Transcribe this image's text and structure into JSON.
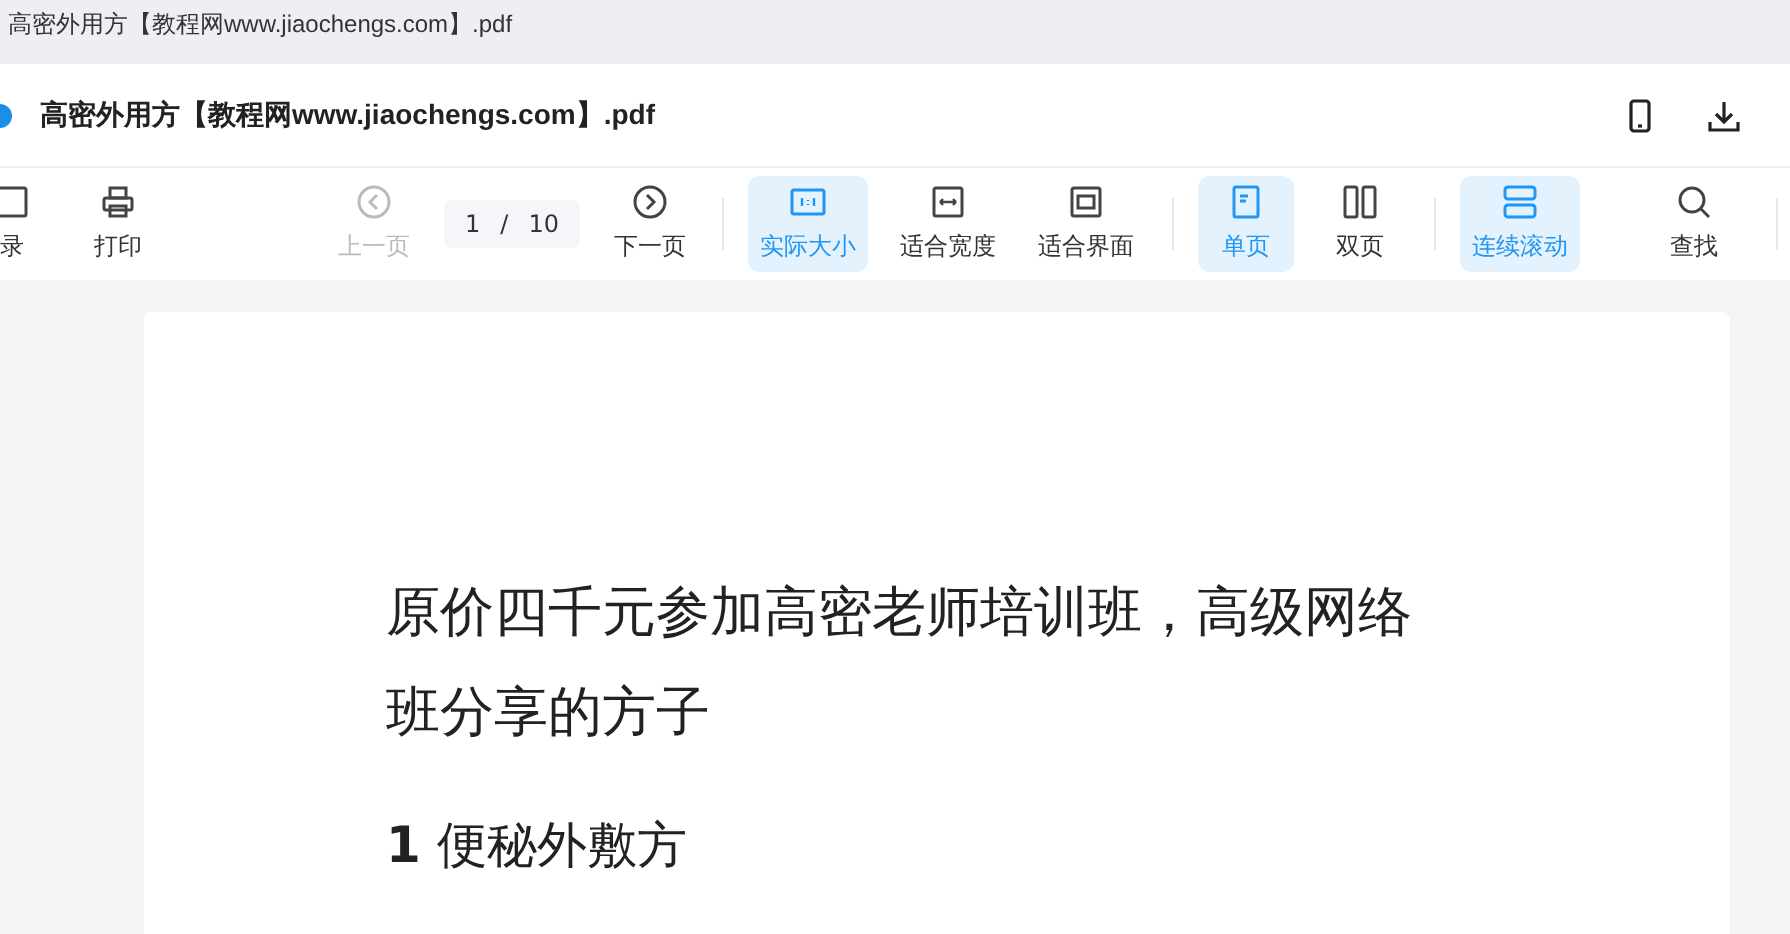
{
  "tab_title": "高密外用方【教程网www.jiaochengs.com】.pdf",
  "header": {
    "title": "高密外用方【教程网www.jiaochengs.com】.pdf"
  },
  "toolbar": [
    {
      "kind": "button",
      "label": "录",
      "selected": false,
      "disabled": false
    },
    {
      "kind": "button",
      "label": "打印",
      "selected": false,
      "disabled": false
    },
    {
      "kind": "button",
      "label": "上一页",
      "selected": false,
      "disabled": true
    },
    {
      "kind": "pager",
      "current": "1",
      "separator": "/",
      "total": "10"
    },
    {
      "kind": "button",
      "label": "下一页",
      "selected": false,
      "disabled": false
    },
    {
      "kind": "divider"
    },
    {
      "kind": "button",
      "label": "实际大小",
      "selected": true,
      "disabled": false
    },
    {
      "kind": "button",
      "label": "适合宽度",
      "selected": false,
      "disabled": false
    },
    {
      "kind": "button",
      "label": "适合界面",
      "selected": false,
      "disabled": false
    },
    {
      "kind": "divider"
    },
    {
      "kind": "button",
      "label": "单页",
      "selected": true,
      "disabled": false
    },
    {
      "kind": "button",
      "label": "双页",
      "selected": false,
      "disabled": false
    },
    {
      "kind": "divider"
    },
    {
      "kind": "button",
      "label": "连续滚动",
      "selected": true,
      "disabled": false
    },
    {
      "kind": "button",
      "label": "查找",
      "selected": false,
      "disabled": false
    },
    {
      "kind": "divider"
    }
  ],
  "document": {
    "heading": "原价四千元参加高密老师培训班，高级网络班分享的方子",
    "section": "**1** 便秘外敷方"
  }
}
